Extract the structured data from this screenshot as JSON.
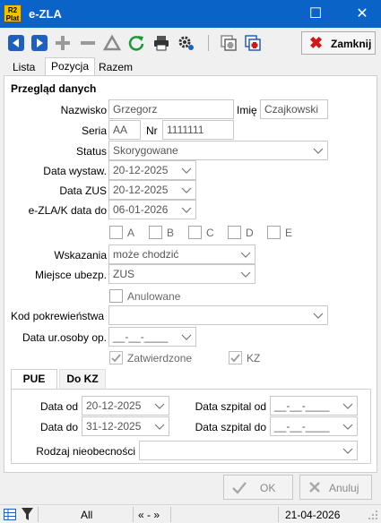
{
  "window": {
    "logo_text": "R2 Plat",
    "title": "e-ZLA",
    "maximize_glyph": "☐",
    "close_glyph": "✕"
  },
  "toolbar": {
    "icons": [
      "prev-icon",
      "next-icon",
      "add-icon",
      "remove-icon",
      "filter-icon",
      "refresh-icon",
      "print-icon",
      "settings-icon",
      "copy-icon",
      "add-copy-icon"
    ],
    "close_label": "Zamknij"
  },
  "tabs": [
    {
      "label": "Lista",
      "active": false
    },
    {
      "label": "Pozycja",
      "active": true
    },
    {
      "label": "Razem",
      "active": false
    }
  ],
  "form": {
    "section_title": "Przegląd danych",
    "nazwisko_label": "Nazwisko",
    "nazwisko_value": "Grzegorz",
    "imie_label": "Imię",
    "imie_value": "Czajkowski",
    "seria_label": "Seria",
    "seria_value": "AA",
    "nr_label": "Nr",
    "nr_value": "1111111",
    "status_label": "Status",
    "status_value": "Skorygowane",
    "data_wystaw_label": "Data wystaw.",
    "data_wystaw_value": "20-12-2025",
    "data_zus_label": "Data ZUS",
    "data_zus_value": "20-12-2025",
    "ezla_k_label": "e-ZLA/K data do",
    "ezla_k_value": "06-01-2026",
    "checkbox_letters": [
      "A",
      "B",
      "C",
      "D",
      "E"
    ],
    "wskazania_label": "Wskazania",
    "wskazania_value": "może chodzić",
    "miejsce_label": "Miejsce ubezp.",
    "miejsce_value": "ZUS",
    "anulowane_label": "Anulowane",
    "kod_label": "Kod pokrewieństwa",
    "kod_value": "",
    "data_ur_label": "Data ur.osoby op.",
    "data_ur_value": "__-__-____",
    "zatwierdzone_label": "Zatwierdzone",
    "kz_label": "KZ"
  },
  "subtabs": [
    {
      "label": "PUE",
      "active": true
    },
    {
      "label": "Do KZ",
      "active": false
    }
  ],
  "pue": {
    "data_od_label": "Data od",
    "data_od_value": "20-12-2025",
    "data_do_label": "Data do",
    "data_do_value": "31-12-2025",
    "szpital_od_label": "Data szpital od",
    "szpital_od_value": "__-__-____",
    "szpital_do_label": "Data szpital do",
    "szpital_do_value": "__-__-____",
    "rodzaj_label": "Rodzaj nieobecności",
    "rodzaj_value": ""
  },
  "buttons": {
    "ok_label": "OK",
    "cancel_label": "Anuluj"
  },
  "statusbar": {
    "filter_value": "All",
    "nav_text": "« - »",
    "date": "21-04-2026"
  },
  "colors": {
    "titlebar": "#0a64c8",
    "nav_blue": "#1f5fbf",
    "refresh_green": "#1a9a3a",
    "close_red": "#d01818"
  }
}
